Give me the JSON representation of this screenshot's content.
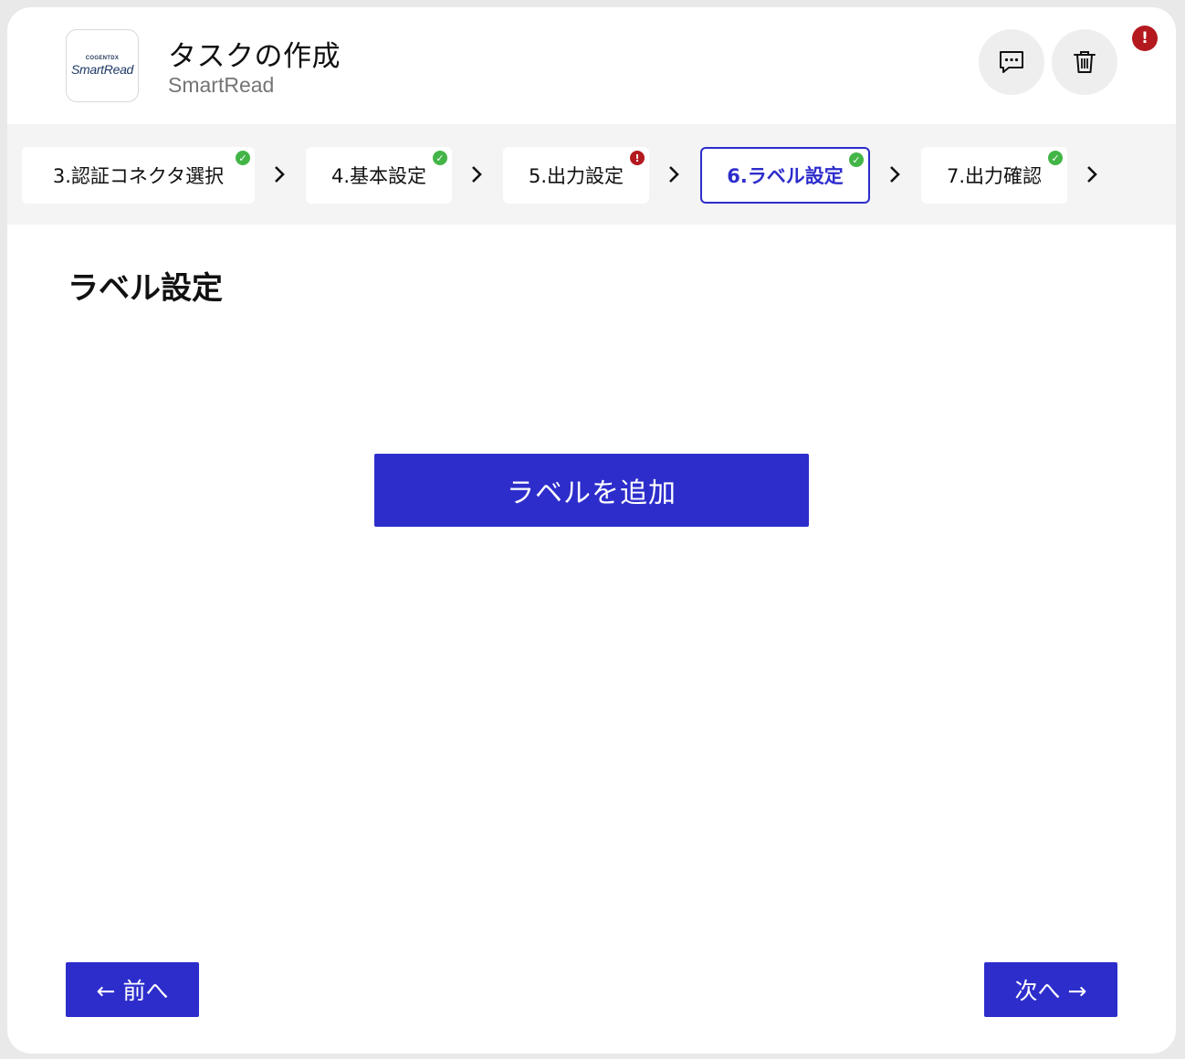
{
  "header": {
    "logo_top": "COGENTDX",
    "logo_main": "SmartRead",
    "title": "タスクの作成",
    "subtitle": "SmartRead",
    "alert_mark": "!"
  },
  "steps": [
    {
      "label": "3.認証コネクタ選択",
      "status": "ok"
    },
    {
      "label": "4.基本設定",
      "status": "ok"
    },
    {
      "label": "5.出力設定",
      "status": "error"
    },
    {
      "label": "6.ラベル設定",
      "status": "ok",
      "active": true
    },
    {
      "label": "7.出力確認",
      "status": "ok"
    }
  ],
  "step_status_marks": {
    "ok": "✓",
    "error": "!"
  },
  "main": {
    "section_title": "ラベル設定",
    "add_label_button": "ラベルを追加"
  },
  "footer": {
    "prev_button": "← 前へ",
    "next_button": "次へ →"
  },
  "colors": {
    "primary": "#2d2dcc",
    "ok": "#43b547",
    "error": "#b3191e",
    "steps_bg": "#f4f4f4"
  }
}
